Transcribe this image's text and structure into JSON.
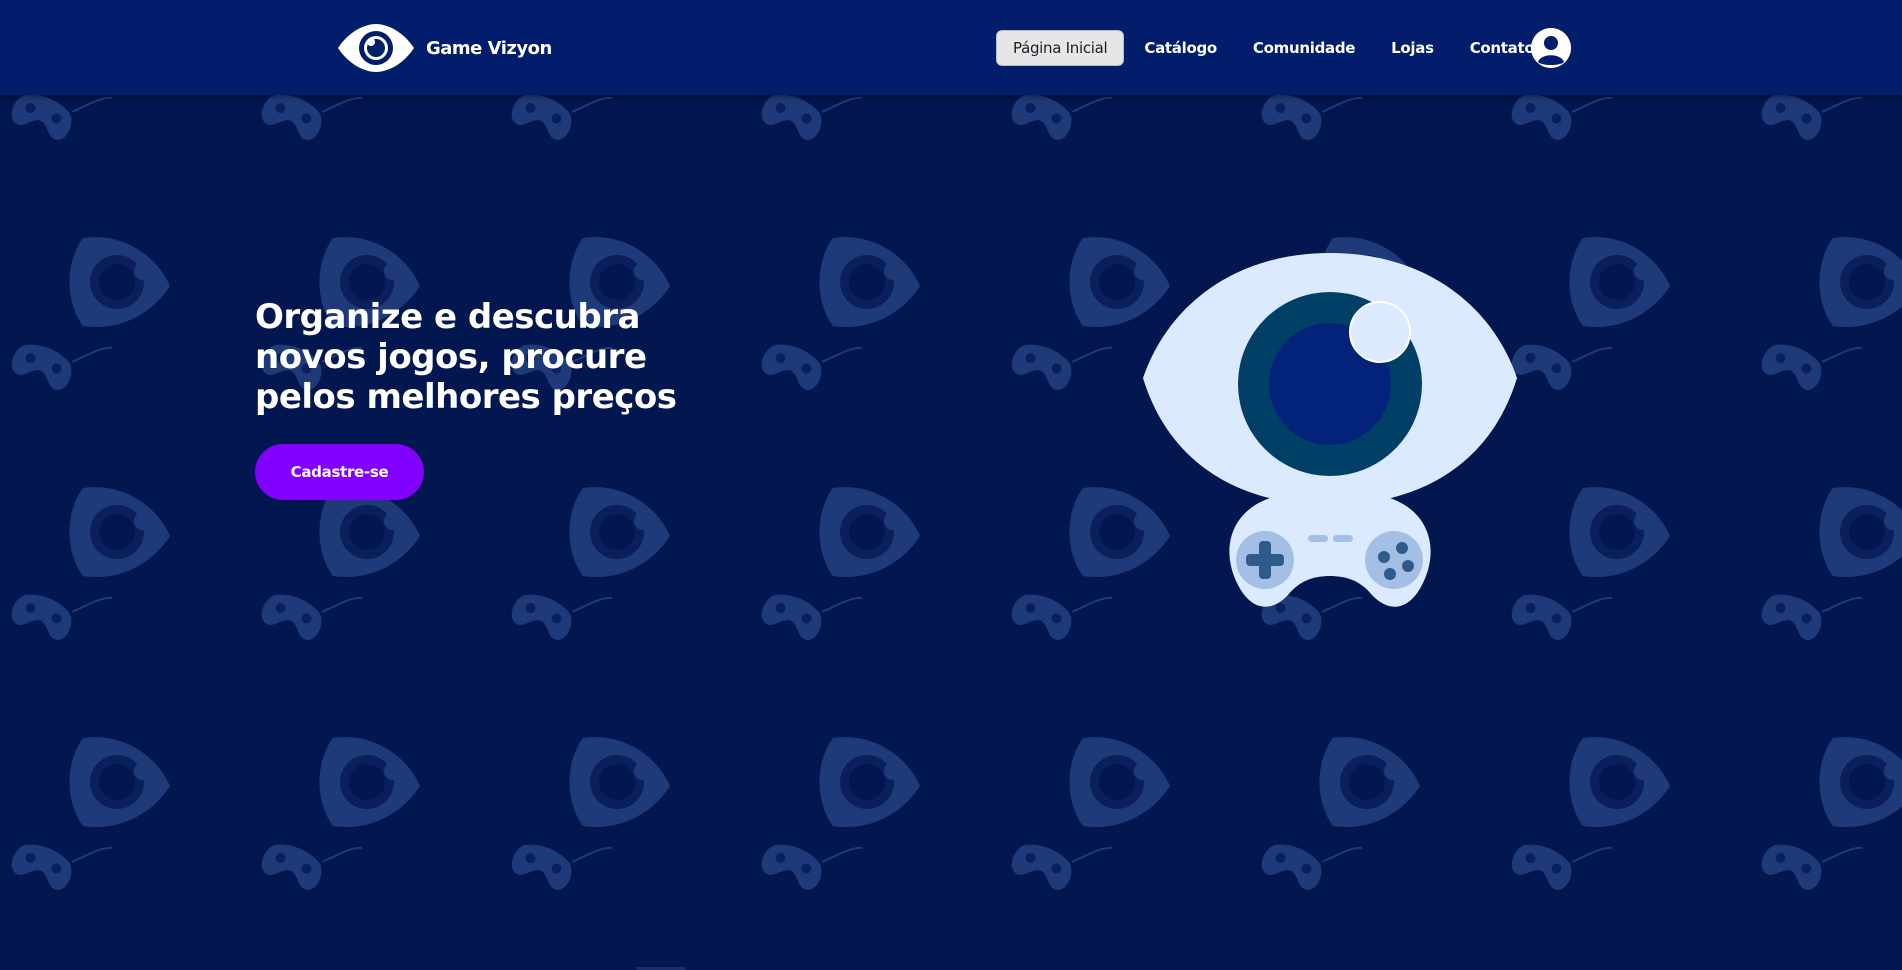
{
  "brand": {
    "name": "Game Vizyon",
    "logo_icon": "eye-logo-icon"
  },
  "nav": {
    "items": [
      {
        "label": "Página Inicial",
        "active": true
      },
      {
        "label": "Catálogo",
        "active": false
      },
      {
        "label": "Comunidade",
        "active": false
      },
      {
        "label": "Lojas",
        "active": false
      },
      {
        "label": "Contato",
        "active": false
      }
    ],
    "user_icon": "user-account-icon"
  },
  "hero": {
    "title": "Organize e descubra novos jogos, procure pelos melhores preços",
    "cta_label": "Cadastre-se",
    "illustration_icon": "eye-gamepad-illustration"
  },
  "colors": {
    "background": "#02164f",
    "navbar": "#011d6b",
    "cta": "#8100ff",
    "active_nav": "#e6e6e6",
    "pattern": "#1f3a78"
  }
}
